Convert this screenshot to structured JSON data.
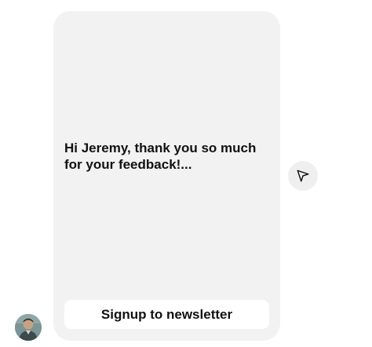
{
  "message": {
    "text": "Hi Jeremy, thank you so much for your feedback!..."
  },
  "cta": {
    "label": "Signup to newsletter"
  },
  "icons": {
    "share": "paper-plane-icon",
    "avatar": "user-avatar"
  },
  "colors": {
    "card_background": "#f2f2f3",
    "button_background": "#ffffff",
    "text": "#111111",
    "share_button_background": "#efeff0"
  }
}
